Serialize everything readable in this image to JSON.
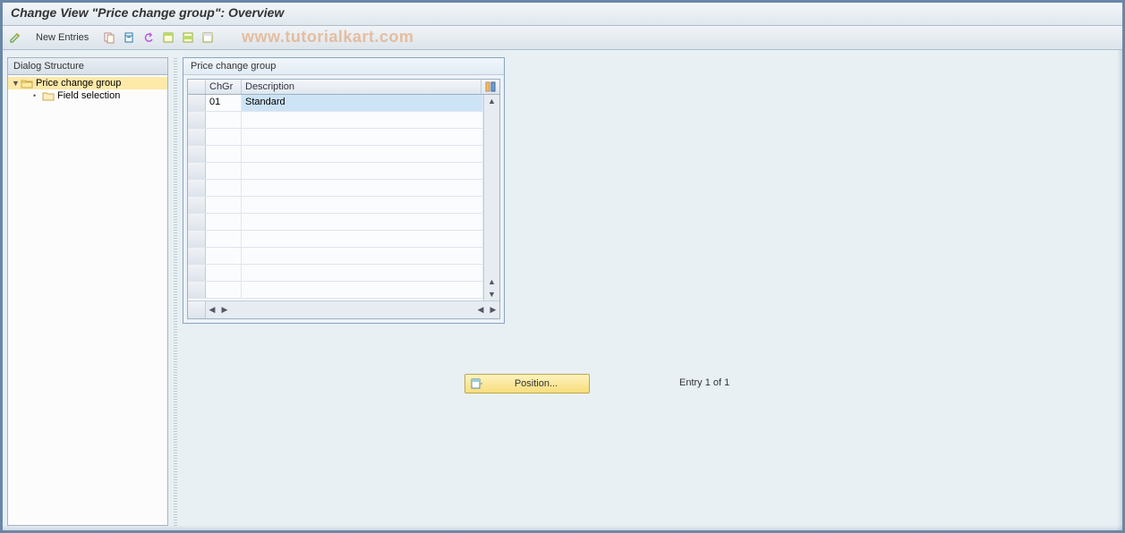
{
  "title": "Change View \"Price change group\": Overview",
  "watermark": "www.tutorialkart.com",
  "toolbar": {
    "new_entries_label": "New Entries"
  },
  "sidebar": {
    "header": "Dialog Structure",
    "items": [
      {
        "label": "Price change group",
        "selected": true
      },
      {
        "label": "Field selection",
        "selected": false
      }
    ]
  },
  "panel": {
    "title": "Price change group",
    "columns": [
      {
        "key": "chgr",
        "label": "ChGr"
      },
      {
        "key": "desc",
        "label": "Description"
      }
    ],
    "rows": [
      {
        "chgr": "01",
        "desc": "Standard"
      }
    ],
    "empty_row_count": 11
  },
  "position_button_label": "Position...",
  "entry_status": "Entry 1 of 1"
}
